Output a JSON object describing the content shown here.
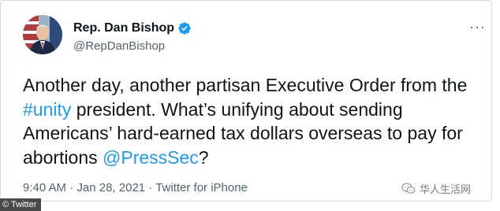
{
  "tweet": {
    "author": {
      "name": "Rep. Dan Bishop",
      "handle": "@RepDanBishop",
      "verified_badge_icon": "verified-check-icon"
    },
    "more_label": "···",
    "text": {
      "part1": "Another day, another partisan Executive Order from the ",
      "hashtag": "#unity",
      "part2": " president. What’s unifying about sending Americans’ hard-earned tax dollars overseas to pay for abortions ",
      "mention": "@PressSec",
      "part3": "?"
    },
    "meta": {
      "time": "9:40 AM",
      "separator1": " · ",
      "date": "Jan 28, 2021",
      "separator2": " · ",
      "source": "Twitter for iPhone"
    }
  },
  "watermark": {
    "label": "华人生活网",
    "icon": "wechat-icon"
  },
  "credit": {
    "label": "© Twitter"
  },
  "colors": {
    "link": "#1d9bf0",
    "text": "#0f1419",
    "secondary": "#536471",
    "border": "#cfd9de"
  }
}
